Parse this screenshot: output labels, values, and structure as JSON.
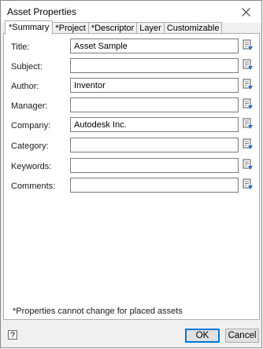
{
  "window": {
    "title": "Asset Properties"
  },
  "tabs": [
    {
      "label": "*Summary",
      "active": true
    },
    {
      "label": "*Project",
      "active": false
    },
    {
      "label": "*Descriptor",
      "active": false
    },
    {
      "label": "Layer",
      "active": false
    },
    {
      "label": "Customizable",
      "active": false
    }
  ],
  "fields": [
    {
      "label": "Title:",
      "value": "Asset Sample"
    },
    {
      "label": "Subject:",
      "value": ""
    },
    {
      "label": "Author:",
      "value": "Inventor"
    },
    {
      "label": "Manager:",
      "value": ""
    },
    {
      "label": "Company:",
      "value": "Autodesk Inc."
    },
    {
      "label": "Category:",
      "value": ""
    },
    {
      "label": "Keywords:",
      "value": ""
    },
    {
      "label": "Comments:",
      "value": ""
    }
  ],
  "note": "*Properties cannot change for placed assets",
  "buttons": {
    "ok": "OK",
    "cancel": "Cancel"
  },
  "icons": {
    "close": "close-icon",
    "field_picker": "property-picker-icon",
    "help": "help-icon"
  },
  "colors": {
    "accent": "#0078d7",
    "border": "#adadad",
    "field_border": "#7a7a7a"
  }
}
